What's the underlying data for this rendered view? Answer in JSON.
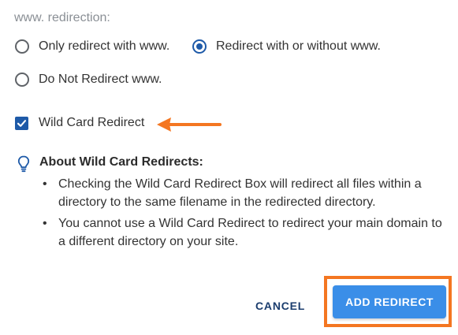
{
  "redirection": {
    "label": "www. redirection:",
    "options": [
      {
        "label": "Only redirect with www.",
        "checked": false
      },
      {
        "label": "Redirect with or without www.",
        "checked": true
      },
      {
        "label": "Do Not Redirect www.",
        "checked": false
      }
    ]
  },
  "wildcard": {
    "label": "Wild Card Redirect",
    "checked": true
  },
  "info": {
    "title": "About Wild Card Redirects:",
    "bullets": [
      "Checking the Wild Card Redirect Box will redirect all files within a directory to the same filename in the redirected directory.",
      "You cannot use a Wild Card Redirect to redirect your main domain to a different directory on your site."
    ]
  },
  "actions": {
    "cancel": "CANCEL",
    "add": "ADD REDIRECT"
  },
  "colors": {
    "primary": "#1e5aa8",
    "button": "#3a8ee8",
    "highlight": "#f47621"
  }
}
